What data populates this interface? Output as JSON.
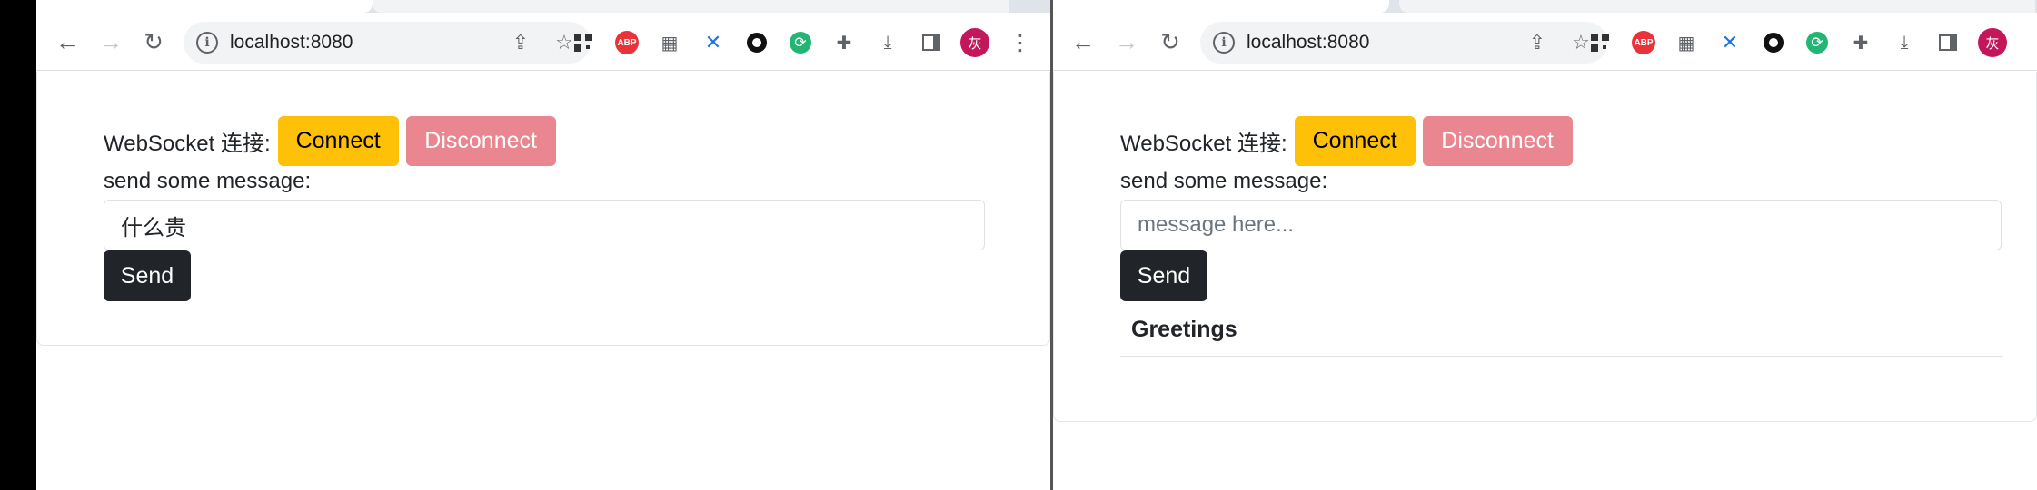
{
  "browser": {
    "url": "localhost:8080",
    "avatar_text": "灰",
    "nav": {
      "back_icon": "arrow-left-icon",
      "forward_icon": "arrow-right-icon",
      "reload_icon": "reload-icon"
    },
    "extensions": [
      "qr-code-icon",
      "adblock-plus-icon",
      "docs-icon",
      "x-icon",
      "ring-icon",
      "sync-icon",
      "puzzle-icon",
      "download-icon",
      "side-panel-icon"
    ]
  },
  "left": {
    "ws_label": "WebSocket 连接:",
    "connect_label": "Connect",
    "disconnect_label": "Disconnect",
    "message_label": "send some message:",
    "message_value": "什么贵",
    "message_placeholder": "message here...",
    "send_label": "Send"
  },
  "right": {
    "ws_label": "WebSocket 连接:",
    "connect_label": "Connect",
    "disconnect_label": "Disconnect",
    "message_label": "send some message:",
    "message_value": "",
    "message_placeholder": "message here...",
    "send_label": "Send",
    "greetings_header": "Greetings"
  },
  "colors": {
    "connect": "#ffc107",
    "disconnect": "#ea868f",
    "send": "#212529",
    "avatar": "#c2185b"
  }
}
